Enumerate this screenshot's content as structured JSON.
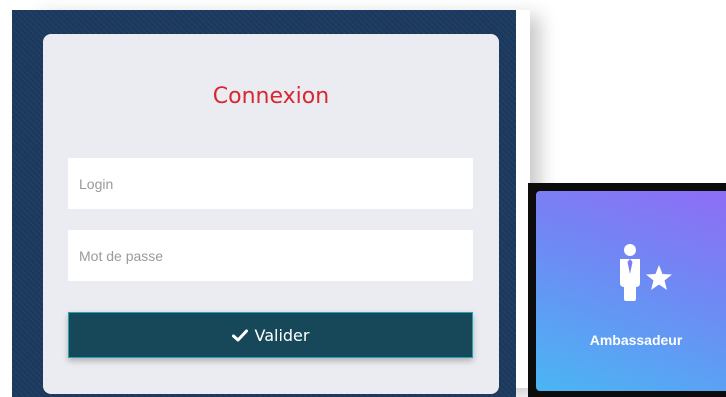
{
  "login": {
    "title": "Connexion",
    "login_placeholder": "Login",
    "login_value": "",
    "password_placeholder": "Mot de passe",
    "password_value": "",
    "submit_label": "Valider",
    "submit_icon": "check-icon"
  },
  "tile": {
    "label": "Ambassadeur",
    "icon": "ambassador-star-icon"
  },
  "colors": {
    "title": "#d8272f",
    "submit_bg": "#17485a",
    "frame_bg": "#1c3a5f",
    "card_bg": "#ebecf1",
    "tile_gradient_top": "#8f6cf5",
    "tile_gradient_bottom": "#4ab6f3"
  }
}
